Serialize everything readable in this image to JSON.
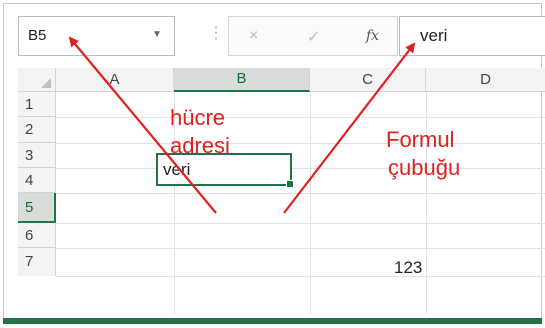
{
  "formula_bar": {
    "name_box_value": "B5",
    "cancel_icon": "×",
    "enter_icon": "✓",
    "fx_label": "fx",
    "formula_value": "veri"
  },
  "columns": [
    "A",
    "B",
    "C",
    "D"
  ],
  "rows": [
    "1",
    "2",
    "3",
    "4",
    "5",
    "6",
    "7"
  ],
  "selected": {
    "column": "B",
    "row": "5"
  },
  "cells": {
    "B5": "veri",
    "C6": "123"
  },
  "annotations": {
    "cell_address_line1": "hücre",
    "cell_address_line2": "adresi",
    "formula_bar_line1": "Formul",
    "formula_bar_line2": "çubuğu",
    "arrow_color": "#e02020"
  },
  "colors": {
    "accent": "#217346",
    "header_bg": "#f3f3f3",
    "selected_header_bg": "#d9ddd9"
  }
}
